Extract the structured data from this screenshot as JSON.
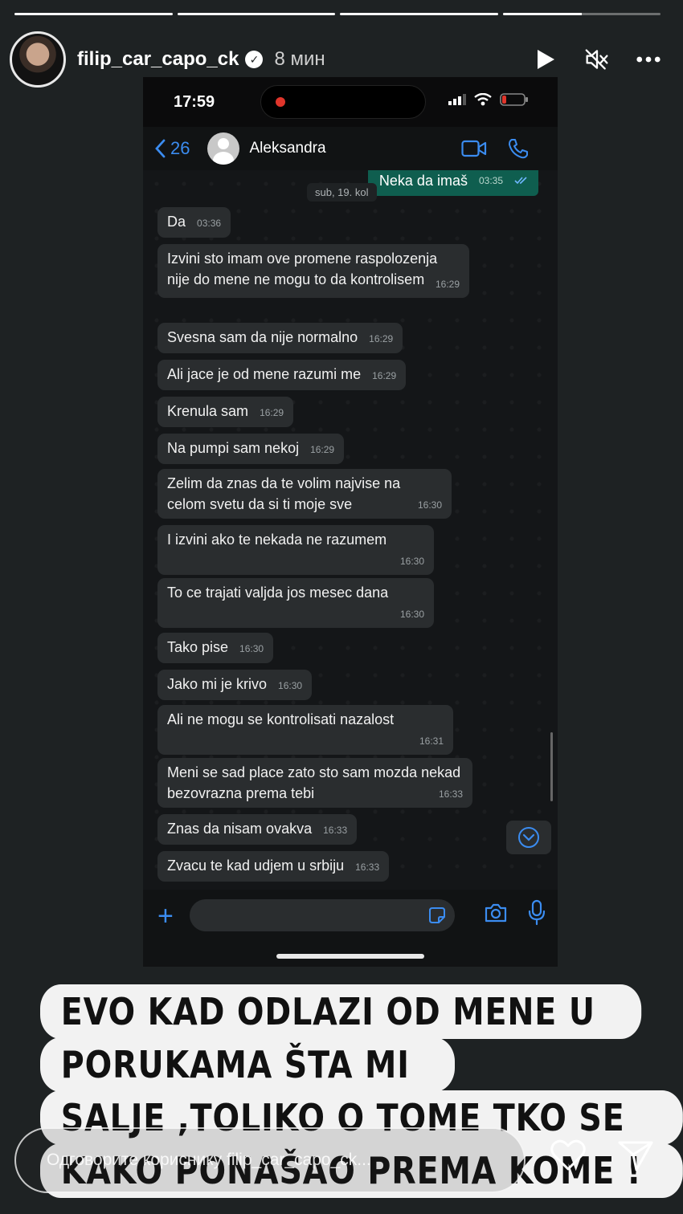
{
  "story": {
    "progress": [
      1,
      1,
      1,
      0.5
    ],
    "username": "filip_car_capo_ck",
    "verified_mark": "✓",
    "time_ago": "8 мин",
    "icons": [
      "play-icon",
      "mute-icon",
      "more-icon"
    ]
  },
  "phone": {
    "status_time": "17:59",
    "chat": {
      "back_count": "26",
      "contact_name": "Aleksandra",
      "sent_message": {
        "text": "Neka da imaš",
        "time": "03:35"
      },
      "date_label": "sub, 19. kol",
      "messages": [
        {
          "text": "Da",
          "time": "03:36"
        },
        {
          "text": "Izvini sto imam ove promene raspolozenja nije do mene ne mogu to da kontrolisem",
          "time": "16:29"
        },
        {
          "text": "Svesna sam da nije normalno",
          "time": "16:29"
        },
        {
          "text": "Ali jace je od mene razumi me",
          "time": "16:29"
        },
        {
          "text": "Krenula sam",
          "time": "16:29"
        },
        {
          "text": "Na pumpi sam nekoj",
          "time": "16:29"
        },
        {
          "text": "Zelim da znas da te volim najvise na celom svetu da si ti moje sve",
          "time": "16:30"
        },
        {
          "text": "I izvini ako te nekada ne razumem",
          "time": "16:30"
        },
        {
          "text": "To ce trajati valjda jos mesec dana",
          "time": "16:30"
        },
        {
          "text": "Tako pise",
          "time": "16:30"
        },
        {
          "text": "Jako mi je krivo",
          "time": "16:30"
        },
        {
          "text": "Ali ne mogu se kontrolisati nazalost",
          "time": "16:31"
        },
        {
          "text": "Meni se sad place zato sto sam mozda nekad bezovrazna prema tebi",
          "time": "16:33"
        },
        {
          "text": "Znas da nisam ovakva",
          "time": "16:33"
        },
        {
          "text": "Zvacu te kad udjem u srbiju",
          "time": "16:33"
        }
      ]
    }
  },
  "caption": {
    "lines": [
      "EVO KAD ODLAZI OD MENE U",
      "PORUKAMA ŠTA MI",
      "SALJE ,TOLIKO O TOME TKO SE",
      "KAKO PONAŠAO PREMA KOME !"
    ]
  },
  "reply": {
    "placeholder": "Одговорите кориснику filip_car_capo_ck..."
  },
  "colors": {
    "background": "#1e2223",
    "accent_blue": "#3b8cf0",
    "sent_bubble": "#0f5e4f",
    "received_bubble": "#2a2d2f"
  }
}
